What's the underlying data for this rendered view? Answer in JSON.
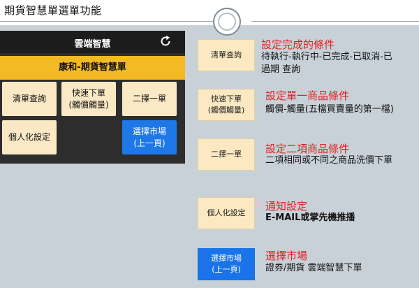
{
  "page": {
    "title": "期貨智慧單選單功能"
  },
  "phone": {
    "app_title": "雲端智慧",
    "refresh_icon": "refresh-icon",
    "subtitle": "康和-期貨智慧單",
    "buttons": {
      "clear_query": "清單查詢",
      "quick_line1": "快速下單",
      "quick_line2": "(觸價觸量)",
      "pick_one": "二擇一單",
      "personal": "個人化設定",
      "market_line1": "選擇市場",
      "market_line2": "(上一頁)"
    }
  },
  "legend": [
    {
      "btn_line1": "清單查詢",
      "btn_line2": "",
      "heading": "設定完成的條件",
      "desc_line1": "待執行-執行中-已完成-已取消-已",
      "desc_line2": "過期 查詢"
    },
    {
      "btn_line1": "快速下單",
      "btn_line2": "(觸價觸量)",
      "heading": "設定單一商品條件",
      "desc_line1": "觸價-觸量(五檔買賣量的第一檔)",
      "desc_line2": ""
    },
    {
      "btn_line1": "二擇一單",
      "btn_line2": "",
      "heading": "設定二項商品條件",
      "desc_line1": "二項相同或不同之商品洗價下單",
      "desc_line2": ""
    },
    {
      "btn_line1": "個人化設定",
      "btn_line2": "",
      "heading": "通知設定",
      "desc_line1": "E-MAIL或掌先機推播",
      "desc_line2": ""
    },
    {
      "btn_line1": "選擇市場",
      "btn_line2": "(上一頁)",
      "heading": "選擇市場",
      "desc_line1": "證券/期貨 雲端智慧下單",
      "desc_line2": ""
    }
  ],
  "colors": {
    "accent_yellow": "#f4ba23",
    "button_cream": "#fbe9c5",
    "button_blue": "#1e78e8",
    "heading_red": "#e02020"
  }
}
